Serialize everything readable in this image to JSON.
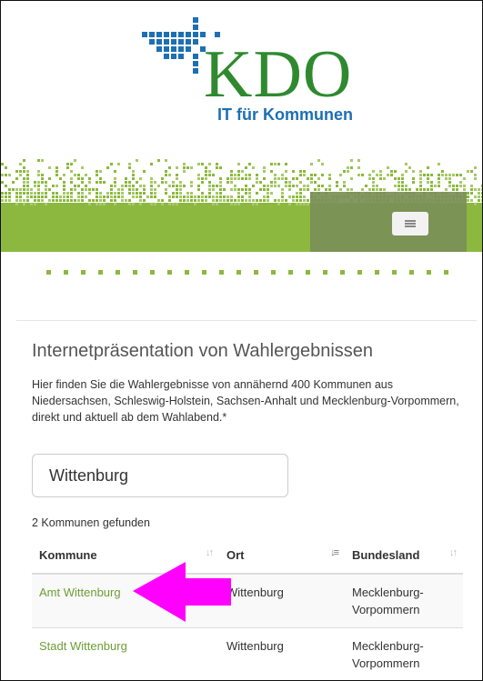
{
  "header": {
    "logo_text": "KDO",
    "logo_subtitle": "IT für Kommunen"
  },
  "colors": {
    "brand_green": "#2f8a2f",
    "brand_blue": "#1d6fb3",
    "banner_green": "#8cb83f",
    "link_green": "#6d9e35",
    "annotation_arrow": "#ff00ff"
  },
  "nav": {
    "menu_icon": "hamburger-icon"
  },
  "main": {
    "title": "Internetpräsentation von Wahlergebnissen",
    "intro": "Hier finden Sie die Wahlergebnisse von annähernd 400 Kommunen aus Niedersachsen, Schleswig-Holstein, Sachsen-Anhalt und Mecklenburg-Vorpommern, direkt und aktuell ab dem Wahlabend.*",
    "search": {
      "value": "Wittenburg"
    },
    "result_count": "2 Kommunen gefunden",
    "table": {
      "columns": [
        "Kommune",
        "Ort",
        "Bundesland"
      ],
      "sorted_column": "Ort",
      "rows": [
        {
          "kommune": "Amt Wittenburg",
          "ort": "Wittenburg",
          "bundesland": "Mecklenburg-Vorpommern"
        },
        {
          "kommune": "Stadt Wittenburg",
          "ort": "Wittenburg",
          "bundesland": "Mecklenburg-Vorpommern"
        }
      ]
    }
  }
}
